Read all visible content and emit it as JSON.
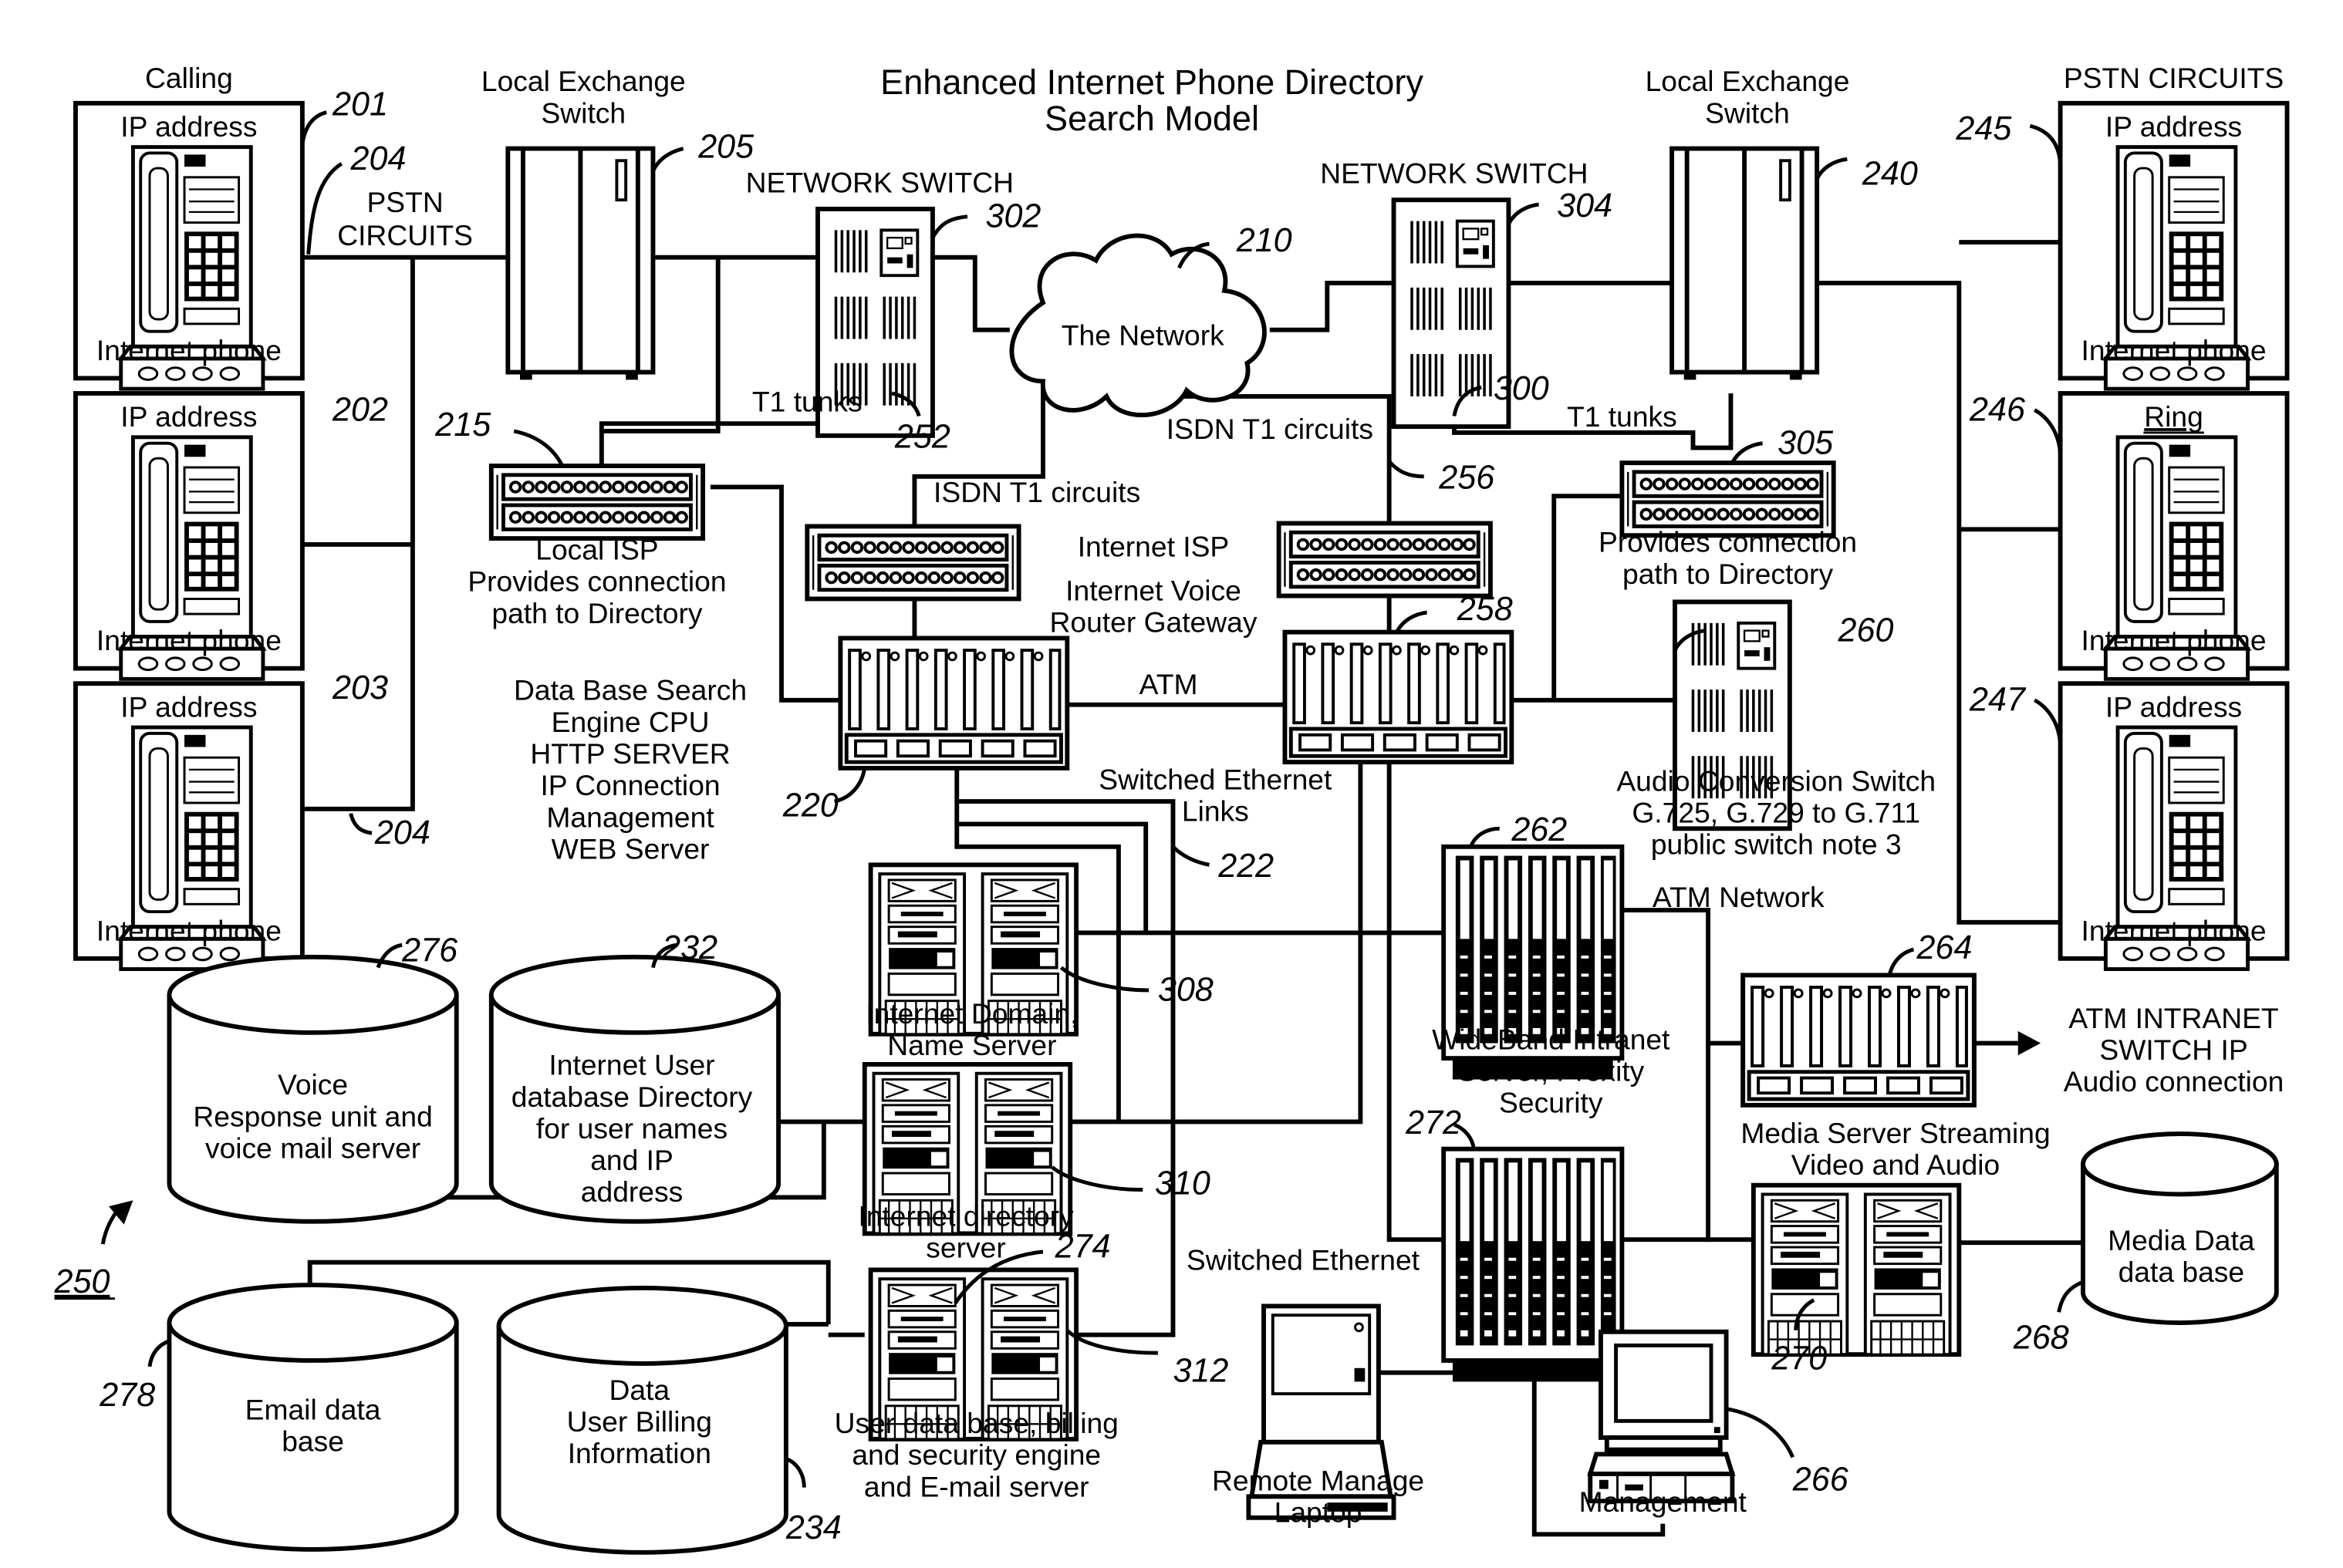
{
  "title": {
    "line1": "Enhanced Internet Phone Directory",
    "line2": "Search Model"
  },
  "labels": {
    "calling": "Calling",
    "pstn_circuits_right": "PSTN CIRCUITS",
    "pstn_left_1": "PSTN",
    "pstn_left_2": "CIRCUITS",
    "lex_left_1": "Local Exchange",
    "lex_left_2": "Switch",
    "lex_right_1": "Local Exchange",
    "lex_right_2": "Switch",
    "netsw_left": "NETWORK SWITCH",
    "netsw_right": "NETWORK SWITCH",
    "network": "The Network",
    "t1_left": "T1 tunks",
    "t1_right": "T1 tunks",
    "isdn_left": "ISDN T1 circuits",
    "isdn_right": "ISDN T1 circuits",
    "local_isp": [
      "Local ISP",
      "Provides connection",
      "path to Directory"
    ],
    "right_isp": [
      "Provides connection",
      "path to Directory"
    ],
    "internet_isp": "Internet ISP",
    "voice_gateway": [
      "Internet Voice",
      "Router Gateway"
    ],
    "atm": "ATM",
    "db_search": [
      "Data Base Search",
      "Engine CPU",
      "HTTP SERVER",
      "IP Connection",
      "Management",
      "WEB Server"
    ],
    "switched_ethernet_links": [
      "Switched Ethernet",
      "Links"
    ],
    "audio_conversion": [
      "Audio Conversion Switch",
      "G.725, G.729 to G.711",
      "public switch note 3"
    ],
    "atm_network": "ATM Network",
    "domain_server": [
      "Internet Domain,",
      "Name Server"
    ],
    "directory_server": [
      "Internet directory",
      "server"
    ],
    "user_db_server": [
      "User data base, billing",
      "and security engine",
      "and E-mail server"
    ],
    "wideband": [
      "WideBand Intranet",
      "Server, Proxity",
      "Security"
    ],
    "atm_intranet": [
      "ATM INTRANET",
      "SWITCH IP",
      "Audio connection"
    ],
    "media_server": [
      "Media Server Streaming",
      "Video and Audio"
    ],
    "media_db": [
      "Media Data",
      "data base"
    ],
    "switched_ethernet": "Switched Ethernet",
    "laptop": [
      "Remote Manage",
      "Laptop"
    ],
    "management": "Management",
    "voice_db": [
      "Voice",
      "Response unit and",
      "voice mail server"
    ],
    "user_db": [
      "Internet User",
      "database Directory",
      "for user names",
      "and IP",
      "address"
    ],
    "email_db": [
      "Email data",
      "base"
    ],
    "billing_db": [
      "Data",
      "User Billing",
      "Information"
    ]
  },
  "phones": [
    {
      "top": "IP address",
      "bottom": "Internet phone",
      "ref": "201"
    },
    {
      "top": "IP address",
      "bottom": "Internet phone",
      "ref": "202"
    },
    {
      "top": "IP address",
      "bottom": "Internet phone",
      "ref": "203"
    },
    {
      "top": "IP address",
      "bottom": "Internet phone",
      "ref": "245"
    },
    {
      "top": "Ring",
      "bottom": "Internet phone",
      "ref": "246"
    },
    {
      "top": "IP address",
      "bottom": "Internet phone",
      "ref": "247"
    }
  ],
  "refs": {
    "r204a": "204",
    "r204b": "204",
    "r205": "205",
    "r302": "302",
    "r210": "210",
    "r304": "304",
    "r240": "240",
    "r215": "215",
    "r252": "252",
    "r300": "300",
    "r305": "305",
    "r256": "256",
    "r258": "258",
    "r260": "260",
    "r220": "220",
    "r222": "222",
    "r262": "262",
    "r308": "308",
    "r310": "310",
    "r264": "264",
    "r272": "272",
    "r274": "274",
    "r312": "312",
    "r276": "276",
    "r232": "232",
    "r278": "278",
    "r234": "234",
    "r250": "250",
    "r268": "268",
    "r270": "270",
    "r266": "266"
  }
}
